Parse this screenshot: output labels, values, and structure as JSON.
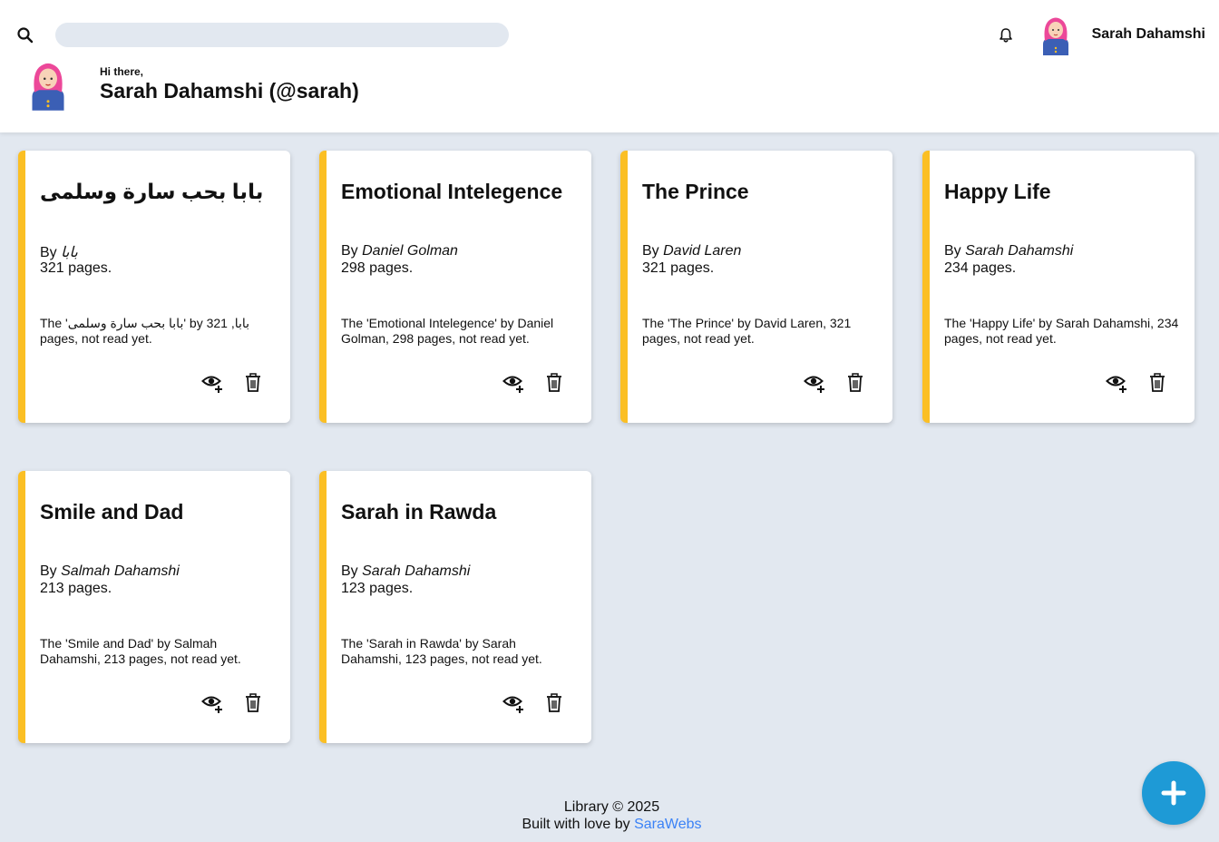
{
  "header": {
    "search": {
      "placeholder": "",
      "value": ""
    },
    "username": "Sarah Dahamshi",
    "greeting_small": "Hi there,",
    "greeting_big": "Sarah Dahamshi (@sarah)"
  },
  "icons": {
    "search": "search-icon",
    "bell": "bell-icon",
    "eye_plus": "eye-plus-icon",
    "trash": "trash-icon",
    "plus": "plus-icon"
  },
  "colors": {
    "accent_border": "#fbbf24",
    "fab": "#1e9ad6",
    "link": "#3b82f6",
    "page_bg": "#e2e8f0"
  },
  "books": [
    {
      "title": "بابا بحب سارة وسلمى",
      "by_label": "By",
      "author": "بابا",
      "pages": "321 pages.",
      "description": "The 'بابا بحب سارة وسلمى' by بابا, 321 pages, not read yet."
    },
    {
      "title": "Emotional Intelegence",
      "by_label": "By",
      "author": "Daniel Golman",
      "pages": "298 pages.",
      "description": "The 'Emotional Intelegence' by Daniel Golman, 298 pages, not read yet."
    },
    {
      "title": "The Prince",
      "by_label": "By",
      "author": "David Laren",
      "pages": "321 pages.",
      "description": "The 'The Prince' by David Laren, 321 pages, not read yet."
    },
    {
      "title": "Happy Life",
      "by_label": "By",
      "author": "Sarah Dahamshi",
      "pages": "234 pages.",
      "description": "The 'Happy Life' by Sarah Dahamshi, 234 pages, not read yet."
    },
    {
      "title": "Smile and Dad",
      "by_label": "By",
      "author": "Salmah Dahamshi",
      "pages": "213 pages.",
      "description": "The 'Smile and Dad' by Salmah Dahamshi, 213 pages, not read yet."
    },
    {
      "title": "Sarah in Rawda",
      "by_label": "By",
      "author": "Sarah Dahamshi",
      "pages": "123 pages.",
      "description": "The 'Sarah in Rawda' by Sarah Dahamshi, 123 pages, not read yet."
    }
  ],
  "footer": {
    "copyright": "Library © 2025",
    "built_with": "Built with love by",
    "link_text": "SaraWebs"
  }
}
